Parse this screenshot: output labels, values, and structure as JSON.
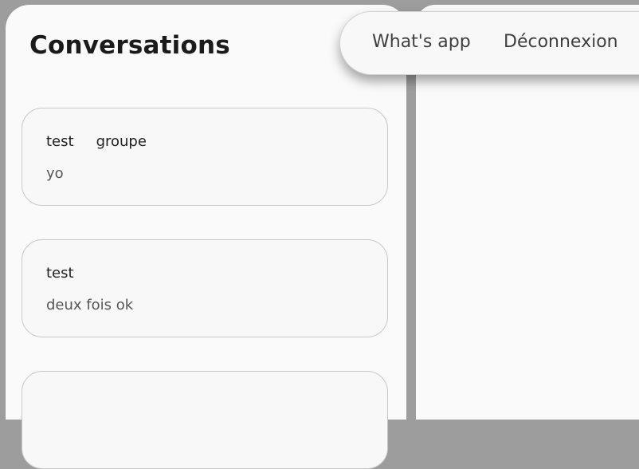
{
  "sidebar": {
    "title": "Conversations",
    "conversations": [
      {
        "name": "test",
        "tag": "groupe",
        "last_message": "yo"
      },
      {
        "name": "test",
        "tag": "",
        "last_message": "deux fois ok"
      },
      {
        "name": "",
        "tag": "",
        "last_message": ""
      }
    ]
  },
  "nav": {
    "home_label": "What's app",
    "logout_label": "Déconnexion"
  }
}
